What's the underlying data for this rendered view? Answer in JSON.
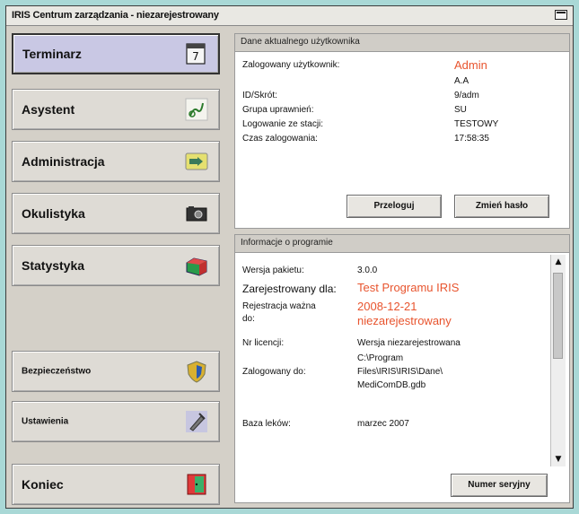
{
  "window": {
    "title": "IRIS Centrum zarządzania - niezarejestrowany"
  },
  "nav": [
    {
      "label": "Terminarz",
      "icon": "calendar-icon"
    },
    {
      "label": "Asystent",
      "icon": "assistant-icon"
    },
    {
      "label": "Administracja",
      "icon": "administration-icon"
    },
    {
      "label": "Okulistyka",
      "icon": "camera-icon"
    },
    {
      "label": "Statystyka",
      "icon": "chart-icon"
    },
    {
      "label": "Bezpieczeństwo",
      "icon": "shield-icon"
    },
    {
      "label": "Ustawienia",
      "icon": "tools-icon"
    },
    {
      "label": "Koniec",
      "icon": "exit-door-icon"
    }
  ],
  "user_panel": {
    "header": "Dane aktualnego użytkownika",
    "rows": [
      {
        "label": "Zalogowany użytkownik:",
        "value": "Admin"
      },
      {
        "label": "",
        "value": "A.A"
      },
      {
        "label": "ID/Skrót:",
        "value": "9/adm"
      },
      {
        "label": "Grupa uprawnień:",
        "value": "SU"
      },
      {
        "label": "Logowanie ze stacji:",
        "value": "TESTOWY"
      },
      {
        "label": "Czas zalogowania:",
        "value": "17:58:35"
      }
    ],
    "relogin_button": "Przeloguj",
    "change_password_button": "Zmień hasło"
  },
  "program_panel": {
    "header": "Informacje o programie",
    "version_label": "Wersja pakietu:",
    "version_value": "3.0.0",
    "registered_label": "Zarejestrowany dla:",
    "registered_value": "Test Programu IRIS",
    "valid_label_1": "Rejestracja ważna",
    "valid_label_2": "do:",
    "valid_value_1": "2008-12-21",
    "valid_value_2": "niezarejestrowany",
    "license_label": "Nr licencji:",
    "license_value": "Wersja niezarejestrowana",
    "logged_to_label": "Zalogowany do:",
    "logged_to_value_1": "C:\\Program",
    "logged_to_value_2": "Files\\IRIS\\IRIS\\Dane\\",
    "logged_to_value_3": "MediComDB.gdb",
    "drug_db_label": "Baza leków:",
    "drug_db_value": "marzec 2007",
    "serial_button": "Numer seryjny"
  },
  "colors": {
    "accent_red": "#e8542e",
    "active_nav": "#c9c8e4",
    "background": "#a9d8d6"
  }
}
